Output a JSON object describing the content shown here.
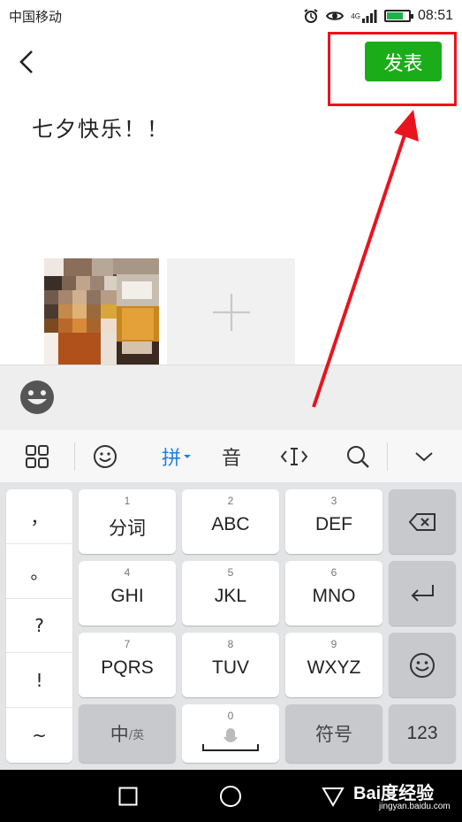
{
  "status_bar": {
    "carrier": "中国移动",
    "network": "4G",
    "time": "08:51",
    "battery_level": 0.75,
    "icons": [
      "alarm-icon",
      "eye-icon",
      "signal-icon",
      "battery-icon"
    ]
  },
  "header": {
    "back_icon": "chevron-left-icon",
    "publish_label": "发表"
  },
  "post": {
    "text": "七夕快乐！！"
  },
  "photos": {
    "add_icon": "plus-icon"
  },
  "emoji_bar": {
    "icon": "smiley-icon"
  },
  "keyboard_toolbar": {
    "grid_icon": "grid-icon",
    "emoji_icon": "smile-outline-icon",
    "pinyin_label": "拼",
    "yin_label": "音",
    "cursor_icon": "cursor-move-icon",
    "search_icon": "search-icon",
    "collapse_icon": "chevron-down-icon"
  },
  "keyboard": {
    "punctuation": [
      "，",
      "。",
      "?",
      "!",
      "~"
    ],
    "keys": [
      {
        "num": "1",
        "label": "分词"
      },
      {
        "num": "2",
        "label": "ABC"
      },
      {
        "num": "3",
        "label": "DEF"
      },
      {
        "num": "4",
        "label": "GHI"
      },
      {
        "num": "5",
        "label": "JKL"
      },
      {
        "num": "6",
        "label": "MNO"
      },
      {
        "num": "7",
        "label": "PQRS"
      },
      {
        "num": "8",
        "label": "TUV"
      },
      {
        "num": "9",
        "label": "WXYZ"
      }
    ],
    "zh_label": "中",
    "en_sub_label": "/英",
    "space_num": "0",
    "symbol_label": "符号",
    "num_label": "123",
    "backspace_icon": "backspace-icon",
    "enter_icon": "enter-icon",
    "emoji_key_icon": "smile-outline-icon",
    "mic_icon": "microphone-icon"
  },
  "nav_bar": {
    "icons": [
      "square-icon",
      "circle-icon",
      "triangle-icon"
    ]
  },
  "watermark": {
    "main": "Bai度经验",
    "sub": "jingyan.baidu.com"
  },
  "colors": {
    "accent_green": "#1aad19",
    "annotation_red": "#e8141e",
    "pinyin_blue": "#1e7ee8"
  }
}
